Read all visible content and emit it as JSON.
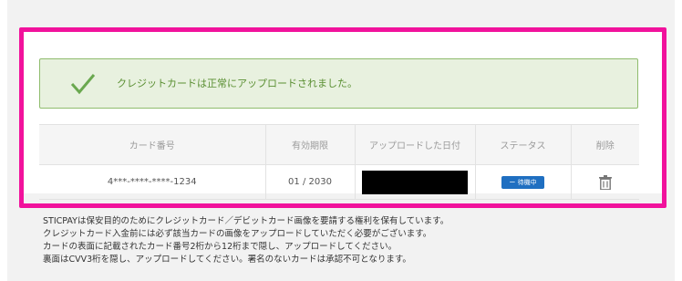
{
  "alert": {
    "message": "クレジットカードは正常にアップロードされました。",
    "icon": "check-icon"
  },
  "table": {
    "headers": [
      "カード番号",
      "有効期限",
      "アップロードした日付",
      "ステータス",
      "削除"
    ],
    "rows": [
      {
        "card_number": "4***-****-****-1234",
        "expiry": "01 / 2030",
        "upload_date": "",
        "status": "ー 待機中"
      }
    ]
  },
  "notes": [
    "STICPAYは保安目的のためにクレジットカード／デビットカード画像を要請する権利を保有しています。",
    "クレジットカード入金前には必ず該当カードの画像をアップロードしていただく必要がございます。",
    "カードの表面に記載されたカード番号2桁から12桁まで隠し、アップロードしてください。",
    "裏面はCVV3桁を隠し、アップロードしてください。署名のないカードは承認不可となります。"
  ],
  "colors": {
    "highlight": "#f1129c",
    "success": "#5a8f32",
    "status": "#1f6fc1"
  }
}
